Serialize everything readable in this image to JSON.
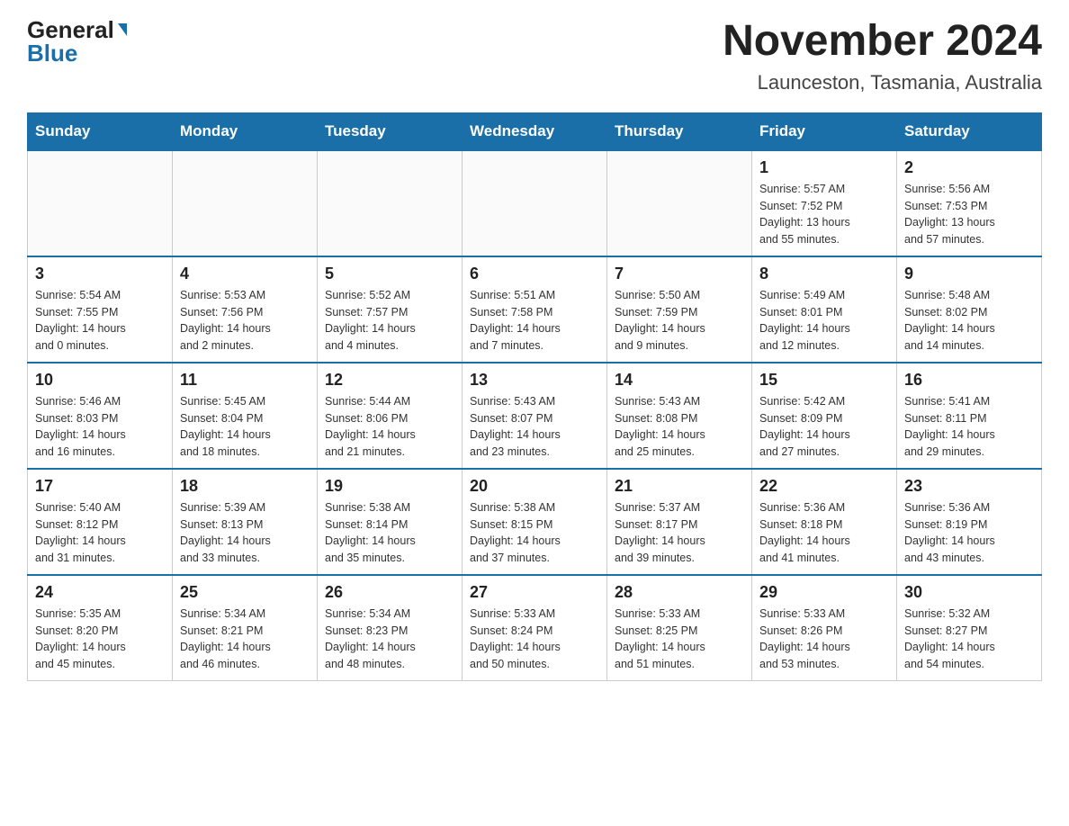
{
  "header": {
    "logo_general": "General",
    "logo_blue": "Blue",
    "month_title": "November 2024",
    "location": "Launceston, Tasmania, Australia"
  },
  "days_of_week": [
    "Sunday",
    "Monday",
    "Tuesday",
    "Wednesday",
    "Thursday",
    "Friday",
    "Saturday"
  ],
  "weeks": [
    [
      {
        "day": "",
        "info": ""
      },
      {
        "day": "",
        "info": ""
      },
      {
        "day": "",
        "info": ""
      },
      {
        "day": "",
        "info": ""
      },
      {
        "day": "",
        "info": ""
      },
      {
        "day": "1",
        "info": "Sunrise: 5:57 AM\nSunset: 7:52 PM\nDaylight: 13 hours\nand 55 minutes."
      },
      {
        "day": "2",
        "info": "Sunrise: 5:56 AM\nSunset: 7:53 PM\nDaylight: 13 hours\nand 57 minutes."
      }
    ],
    [
      {
        "day": "3",
        "info": "Sunrise: 5:54 AM\nSunset: 7:55 PM\nDaylight: 14 hours\nand 0 minutes."
      },
      {
        "day": "4",
        "info": "Sunrise: 5:53 AM\nSunset: 7:56 PM\nDaylight: 14 hours\nand 2 minutes."
      },
      {
        "day": "5",
        "info": "Sunrise: 5:52 AM\nSunset: 7:57 PM\nDaylight: 14 hours\nand 4 minutes."
      },
      {
        "day": "6",
        "info": "Sunrise: 5:51 AM\nSunset: 7:58 PM\nDaylight: 14 hours\nand 7 minutes."
      },
      {
        "day": "7",
        "info": "Sunrise: 5:50 AM\nSunset: 7:59 PM\nDaylight: 14 hours\nand 9 minutes."
      },
      {
        "day": "8",
        "info": "Sunrise: 5:49 AM\nSunset: 8:01 PM\nDaylight: 14 hours\nand 12 minutes."
      },
      {
        "day": "9",
        "info": "Sunrise: 5:48 AM\nSunset: 8:02 PM\nDaylight: 14 hours\nand 14 minutes."
      }
    ],
    [
      {
        "day": "10",
        "info": "Sunrise: 5:46 AM\nSunset: 8:03 PM\nDaylight: 14 hours\nand 16 minutes."
      },
      {
        "day": "11",
        "info": "Sunrise: 5:45 AM\nSunset: 8:04 PM\nDaylight: 14 hours\nand 18 minutes."
      },
      {
        "day": "12",
        "info": "Sunrise: 5:44 AM\nSunset: 8:06 PM\nDaylight: 14 hours\nand 21 minutes."
      },
      {
        "day": "13",
        "info": "Sunrise: 5:43 AM\nSunset: 8:07 PM\nDaylight: 14 hours\nand 23 minutes."
      },
      {
        "day": "14",
        "info": "Sunrise: 5:43 AM\nSunset: 8:08 PM\nDaylight: 14 hours\nand 25 minutes."
      },
      {
        "day": "15",
        "info": "Sunrise: 5:42 AM\nSunset: 8:09 PM\nDaylight: 14 hours\nand 27 minutes."
      },
      {
        "day": "16",
        "info": "Sunrise: 5:41 AM\nSunset: 8:11 PM\nDaylight: 14 hours\nand 29 minutes."
      }
    ],
    [
      {
        "day": "17",
        "info": "Sunrise: 5:40 AM\nSunset: 8:12 PM\nDaylight: 14 hours\nand 31 minutes."
      },
      {
        "day": "18",
        "info": "Sunrise: 5:39 AM\nSunset: 8:13 PM\nDaylight: 14 hours\nand 33 minutes."
      },
      {
        "day": "19",
        "info": "Sunrise: 5:38 AM\nSunset: 8:14 PM\nDaylight: 14 hours\nand 35 minutes."
      },
      {
        "day": "20",
        "info": "Sunrise: 5:38 AM\nSunset: 8:15 PM\nDaylight: 14 hours\nand 37 minutes."
      },
      {
        "day": "21",
        "info": "Sunrise: 5:37 AM\nSunset: 8:17 PM\nDaylight: 14 hours\nand 39 minutes."
      },
      {
        "day": "22",
        "info": "Sunrise: 5:36 AM\nSunset: 8:18 PM\nDaylight: 14 hours\nand 41 minutes."
      },
      {
        "day": "23",
        "info": "Sunrise: 5:36 AM\nSunset: 8:19 PM\nDaylight: 14 hours\nand 43 minutes."
      }
    ],
    [
      {
        "day": "24",
        "info": "Sunrise: 5:35 AM\nSunset: 8:20 PM\nDaylight: 14 hours\nand 45 minutes."
      },
      {
        "day": "25",
        "info": "Sunrise: 5:34 AM\nSunset: 8:21 PM\nDaylight: 14 hours\nand 46 minutes."
      },
      {
        "day": "26",
        "info": "Sunrise: 5:34 AM\nSunset: 8:23 PM\nDaylight: 14 hours\nand 48 minutes."
      },
      {
        "day": "27",
        "info": "Sunrise: 5:33 AM\nSunset: 8:24 PM\nDaylight: 14 hours\nand 50 minutes."
      },
      {
        "day": "28",
        "info": "Sunrise: 5:33 AM\nSunset: 8:25 PM\nDaylight: 14 hours\nand 51 minutes."
      },
      {
        "day": "29",
        "info": "Sunrise: 5:33 AM\nSunset: 8:26 PM\nDaylight: 14 hours\nand 53 minutes."
      },
      {
        "day": "30",
        "info": "Sunrise: 5:32 AM\nSunset: 8:27 PM\nDaylight: 14 hours\nand 54 minutes."
      }
    ]
  ]
}
